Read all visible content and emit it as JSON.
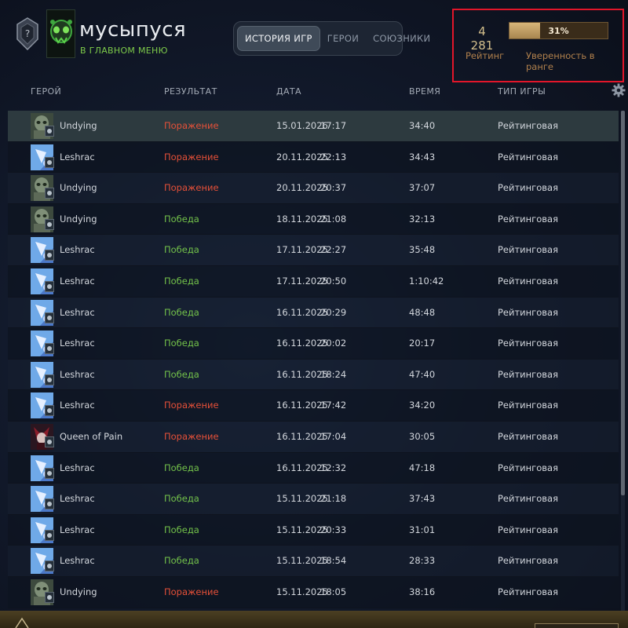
{
  "header": {
    "username": "мусыпуся",
    "status": "В ГЛАВНОМ МЕНЮ",
    "tabs": [
      {
        "label": "ИСТОРИЯ ИГР",
        "active": true
      },
      {
        "label": "ГЕРОИ",
        "active": false
      },
      {
        "label": "СОЮЗНИКИ",
        "active": false
      }
    ],
    "rating": {
      "value": "4 281",
      "label": "Рейтинг",
      "confidence_percent": 31,
      "confidence_text": "31%",
      "confidence_label": "Уверенность в ранге"
    }
  },
  "columns": {
    "hero": "ГЕРОЙ",
    "result": "РЕЗУЛЬТАТ",
    "date": "ДАТА",
    "time": "ВРЕМЯ",
    "type": "ТИП ИГРЫ"
  },
  "colors": {
    "loss": "#e65038",
    "win": "#73c24a",
    "highlight": "#e2162a"
  },
  "matches": [
    {
      "hero": "Undying",
      "hero_icon": "undying-icon",
      "result": "Поражение",
      "win": false,
      "date": "15.01.2026",
      "time": "17:17",
      "duration": "34:40",
      "type": "Рейтинговая",
      "selected": true
    },
    {
      "hero": "Leshrac",
      "hero_icon": "leshrac-icon",
      "result": "Поражение",
      "win": false,
      "date": "20.11.2025",
      "time": "22:13",
      "duration": "34:43",
      "type": "Рейтинговая"
    },
    {
      "hero": "Undying",
      "hero_icon": "undying-icon",
      "result": "Поражение",
      "win": false,
      "date": "20.11.2025",
      "time": "20:37",
      "duration": "37:07",
      "type": "Рейтинговая"
    },
    {
      "hero": "Undying",
      "hero_icon": "undying-icon",
      "result": "Победа",
      "win": true,
      "date": "18.11.2025",
      "time": "21:08",
      "duration": "32:13",
      "type": "Рейтинговая"
    },
    {
      "hero": "Leshrac",
      "hero_icon": "leshrac-icon",
      "result": "Победа",
      "win": true,
      "date": "17.11.2025",
      "time": "22:27",
      "duration": "35:48",
      "type": "Рейтинговая"
    },
    {
      "hero": "Leshrac",
      "hero_icon": "leshrac-icon",
      "result": "Победа",
      "win": true,
      "date": "17.11.2025",
      "time": "20:50",
      "duration": "1:10:42",
      "type": "Рейтинговая"
    },
    {
      "hero": "Leshrac",
      "hero_icon": "leshrac-icon",
      "result": "Победа",
      "win": true,
      "date": "16.11.2025",
      "time": "20:29",
      "duration": "48:48",
      "type": "Рейтинговая"
    },
    {
      "hero": "Leshrac",
      "hero_icon": "leshrac-icon",
      "result": "Победа",
      "win": true,
      "date": "16.11.2025",
      "time": "20:02",
      "duration": "20:17",
      "type": "Рейтинговая"
    },
    {
      "hero": "Leshrac",
      "hero_icon": "leshrac-icon",
      "result": "Победа",
      "win": true,
      "date": "16.11.2025",
      "time": "18:24",
      "duration": "47:40",
      "type": "Рейтинговая"
    },
    {
      "hero": "Leshrac",
      "hero_icon": "leshrac-icon",
      "result": "Поражение",
      "win": false,
      "date": "16.11.2025",
      "time": "17:42",
      "duration": "34:20",
      "type": "Рейтинговая"
    },
    {
      "hero": "Queen of Pain",
      "hero_icon": "queen-of-pain-icon",
      "result": "Поражение",
      "win": false,
      "date": "16.11.2025",
      "time": "17:04",
      "duration": "30:05",
      "type": "Рейтинговая"
    },
    {
      "hero": "Leshrac",
      "hero_icon": "leshrac-icon",
      "result": "Победа",
      "win": true,
      "date": "16.11.2025",
      "time": "12:32",
      "duration": "47:18",
      "type": "Рейтинговая"
    },
    {
      "hero": "Leshrac",
      "hero_icon": "leshrac-icon",
      "result": "Победа",
      "win": true,
      "date": "15.11.2025",
      "time": "21:18",
      "duration": "37:43",
      "type": "Рейтинговая"
    },
    {
      "hero": "Leshrac",
      "hero_icon": "leshrac-icon",
      "result": "Победа",
      "win": true,
      "date": "15.11.2025",
      "time": "20:33",
      "duration": "31:01",
      "type": "Рейтинговая"
    },
    {
      "hero": "Leshrac",
      "hero_icon": "leshrac-icon",
      "result": "Победа",
      "win": true,
      "date": "15.11.2025",
      "time": "18:54",
      "duration": "28:33",
      "type": "Рейтинговая"
    },
    {
      "hero": "Undying",
      "hero_icon": "undying-icon",
      "result": "Поражение",
      "win": false,
      "date": "15.11.2025",
      "time": "18:05",
      "duration": "38:16",
      "type": "Рейтинговая"
    }
  ]
}
